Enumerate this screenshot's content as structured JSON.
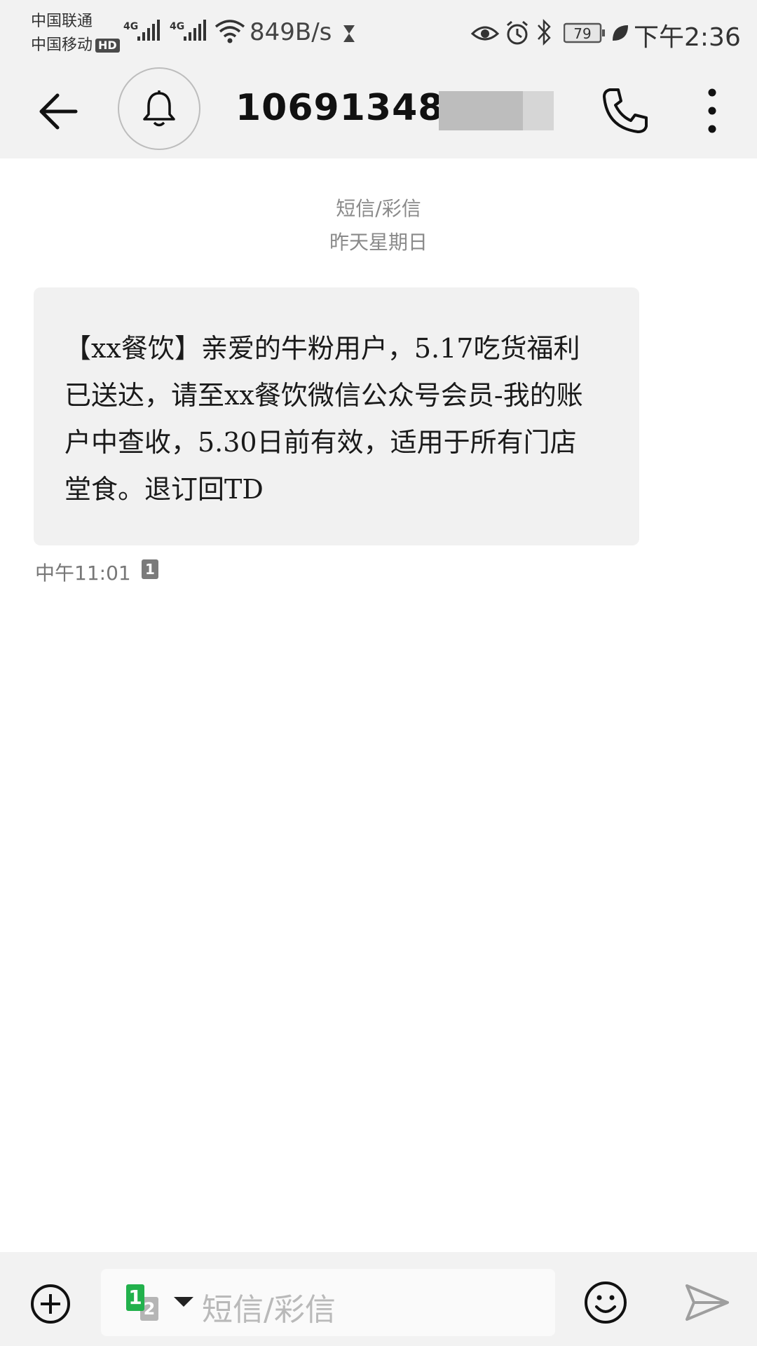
{
  "status_bar": {
    "carrier_1": "中国联通",
    "carrier_2": "中国移动",
    "hd_badge": "HD",
    "network_1": "4G",
    "network_2": "4G",
    "net_speed": "849B/s",
    "battery_level": "79",
    "time": "下午2:36"
  },
  "app_bar": {
    "contact_number": "1069134828"
  },
  "conversation": {
    "type_label": "短信/彩信",
    "date_label": "昨天星期日"
  },
  "message": {
    "text": "【xx餐饮】亲爱的牛粉用户，5.17吃货福利已送达，请至xx餐饮微信公众号会员-我的账户中查收，5.30日前有效，适用于所有门店堂食。退订回TD",
    "time": "中午11:01",
    "sim": "1"
  },
  "composer": {
    "sim_primary": "1",
    "sim_secondary": "2",
    "placeholder": "短信/彩信"
  }
}
